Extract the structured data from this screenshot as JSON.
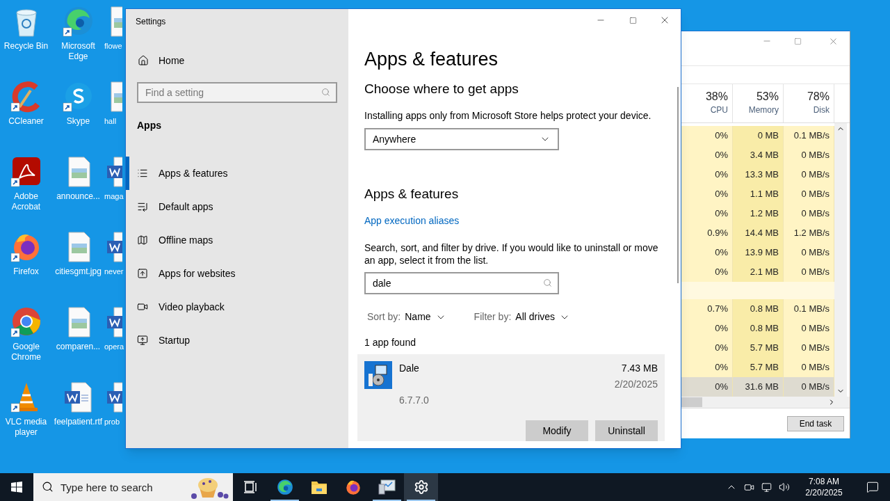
{
  "desktop": {
    "columns": [
      [
        {
          "label": "Recycle Bin",
          "kind": "recycle",
          "shortcut": false
        },
        {
          "label": "CCleaner",
          "kind": "ccleaner",
          "shortcut": true
        },
        {
          "label": "Adobe Acrobat",
          "kind": "acrobat",
          "shortcut": true
        },
        {
          "label": "Firefox",
          "kind": "firefox",
          "shortcut": true
        },
        {
          "label": "Google Chrome",
          "kind": "chrome",
          "shortcut": true
        },
        {
          "label": "VLC media player",
          "kind": "vlc",
          "shortcut": true
        }
      ],
      [
        {
          "label": "Microsoft Edge",
          "kind": "edge",
          "shortcut": true
        },
        {
          "label": "Skype",
          "kind": "skype",
          "shortcut": true
        },
        {
          "label": "announce...",
          "kind": "image",
          "shortcut": false
        },
        {
          "label": "citiesgmt.jpg",
          "kind": "image",
          "shortcut": false
        },
        {
          "label": "comparen...",
          "kind": "image",
          "shortcut": false
        },
        {
          "label": "feelpatient.rtf",
          "kind": "word",
          "shortcut": false
        }
      ],
      [
        {
          "label": "flowe",
          "kind": "image",
          "shortcut": false
        },
        {
          "label": "hall",
          "kind": "image",
          "shortcut": false
        },
        {
          "label": "maga",
          "kind": "word",
          "shortcut": false
        },
        {
          "label": "never",
          "kind": "word",
          "shortcut": false
        },
        {
          "label": "opera",
          "kind": "word",
          "shortcut": false
        },
        {
          "label": "prob",
          "kind": "word",
          "shortcut": false
        }
      ]
    ]
  },
  "settings": {
    "title": "Settings",
    "home": "Home",
    "search_placeholder": "Find a setting",
    "section": "Apps",
    "nav": [
      {
        "label": "Apps & features",
        "kind": "list",
        "selected": true
      },
      {
        "label": "Default apps",
        "kind": "defaults",
        "selected": false
      },
      {
        "label": "Offline maps",
        "kind": "map",
        "selected": false
      },
      {
        "label": "Apps for websites",
        "kind": "web",
        "selected": false
      },
      {
        "label": "Video playback",
        "kind": "video",
        "selected": false
      },
      {
        "label": "Startup",
        "kind": "startup",
        "selected": false
      }
    ],
    "heading": "Apps & features",
    "subheading": "Choose where to get apps",
    "description": "Installing apps only from Microsoft Store helps protect your device.",
    "source": "Anywhere",
    "section2": "Apps & features",
    "link": "App execution aliases",
    "paragraph": "Search, sort, and filter by drive. If you would like to uninstall or move an app, select it from the list.",
    "search_value": "dale",
    "sort_label": "Sort by:",
    "sort_value": "Name",
    "filter_label": "Filter by:",
    "filter_value": "All drives",
    "count": "1 app found",
    "apps": [
      {
        "name": "Dale",
        "size": "7.43 MB",
        "date": "2/20/2025",
        "version": "6.7.7.0",
        "selected": true
      }
    ],
    "actions": [
      "Modify",
      "Uninstall"
    ]
  },
  "task_manager": {
    "summary": [
      {
        "percent": "38%",
        "label": "CPU"
      },
      {
        "percent": "53%",
        "label": "Memory"
      },
      {
        "percent": "78%",
        "label": "Disk"
      }
    ],
    "rows": [
      {
        "kind": "process",
        "cells": [
          "0%",
          "0 MB",
          "0.1 MB/s"
        ],
        "selected": false
      },
      {
        "kind": "process",
        "cells": [
          "0%",
          "3.4 MB",
          "0 MB/s"
        ],
        "selected": false
      },
      {
        "kind": "process",
        "cells": [
          "0%",
          "13.3 MB",
          "0 MB/s"
        ],
        "selected": false
      },
      {
        "kind": "process",
        "cells": [
          "0%",
          "1.1 MB",
          "0 MB/s"
        ],
        "selected": false
      },
      {
        "kind": "process",
        "cells": [
          "0%",
          "1.2 MB",
          "0 MB/s"
        ],
        "selected": false
      },
      {
        "kind": "process",
        "cells": [
          "0.9%",
          "14.4 MB",
          "1.2 MB/s"
        ],
        "selected": false
      },
      {
        "kind": "process",
        "cells": [
          "0%",
          "13.9 MB",
          "0 MB/s"
        ],
        "selected": false
      },
      {
        "kind": "process",
        "cells": [
          "0%",
          "2.1 MB",
          "0 MB/s"
        ],
        "selected": false
      },
      {
        "kind": "spacer"
      },
      {
        "kind": "process",
        "cells": [
          "0.7%",
          "0.8 MB",
          "0.1 MB/s"
        ],
        "selected": false
      },
      {
        "kind": "process",
        "cells": [
          "0%",
          "0.8 MB",
          "0 MB/s"
        ],
        "selected": false
      },
      {
        "kind": "process",
        "cells": [
          "0%",
          "5.7 MB",
          "0 MB/s"
        ],
        "selected": false
      },
      {
        "kind": "process",
        "cells": [
          "0%",
          "5.7 MB",
          "0 MB/s"
        ],
        "selected": false
      },
      {
        "kind": "process",
        "cells": [
          "0%",
          "31.6 MB",
          "0 MB/s"
        ],
        "selected": true
      }
    ],
    "button": "End task"
  },
  "taskbar": {
    "search_placeholder": "Type here to search",
    "apps": [
      {
        "kind": "taskview",
        "running": false,
        "selected": false
      },
      {
        "kind": "edge",
        "running": true,
        "selected": false
      },
      {
        "kind": "explorer",
        "running": false,
        "selected": false
      },
      {
        "kind": "firefox",
        "running": false,
        "selected": false
      },
      {
        "kind": "taskmgr",
        "running": true,
        "selected": false
      },
      {
        "kind": "settings",
        "running": true,
        "selected": true
      }
    ],
    "time": "7:08 AM",
    "date": "2/20/2025"
  }
}
